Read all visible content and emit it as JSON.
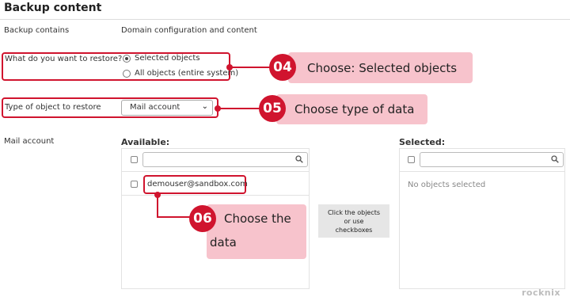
{
  "page": {
    "title": "Backup content"
  },
  "backup": {
    "label": "Backup contains",
    "value": "Domain configuration and content"
  },
  "restore": {
    "question": "What do you want to restore?",
    "options": [
      {
        "label": "Selected objects",
        "selected": true
      },
      {
        "label": "All objects (entire system)",
        "selected": false
      }
    ]
  },
  "object_type": {
    "label": "Type of object to restore",
    "selected_value": "Mail account",
    "chevron": "⌄"
  },
  "mail_account": {
    "label": "Mail account",
    "available": {
      "header": "Available:",
      "items": [
        "demouser@sandbox.com"
      ]
    },
    "selected": {
      "header": "Selected:",
      "empty_text": "No objects selected"
    },
    "move_button": [
      "Click the objects",
      "or use",
      "checkboxes"
    ]
  },
  "callouts": [
    {
      "number": "04",
      "text": "Choose: Selected objects"
    },
    {
      "number": "05",
      "text": "Choose type of data"
    },
    {
      "number": "06",
      "text_line1": "Choose the",
      "text_line2": "data"
    }
  ],
  "watermark": "rocknix",
  "colors": {
    "accent": "#d0142e",
    "callout_bg": "#f7c3cc"
  }
}
